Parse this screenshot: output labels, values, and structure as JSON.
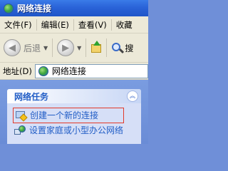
{
  "window": {
    "title": "网络连接"
  },
  "menu": [
    "文件(F)",
    "编辑(E)",
    "查看(V)",
    "收藏"
  ],
  "toolbar": {
    "back_label": "后退",
    "search_label": "搜"
  },
  "address": {
    "label": "地址(D)",
    "value": "网络连接"
  },
  "task_pane": {
    "title": "网络任务",
    "items": [
      {
        "label": "创建一个新的连接"
      },
      {
        "label": "设置家庭或小型办公网络"
      }
    ]
  }
}
